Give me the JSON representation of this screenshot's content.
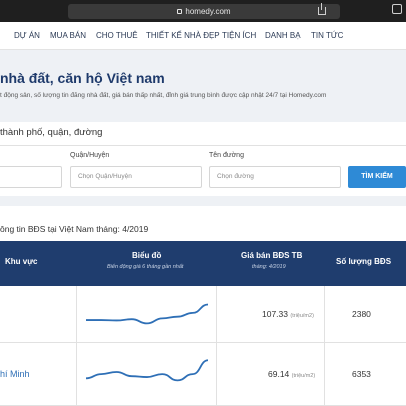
{
  "browser": {
    "url": "homedy.com"
  },
  "nav": {
    "items": [
      "DỰ ÁN",
      "MUA BÁN",
      "CHO THUÊ",
      "THIẾT KẾ NHÀ ĐẸP",
      "TIỆN ÍCH",
      "DANH BẠ",
      "TIN TỨC"
    ]
  },
  "hero": {
    "title": "nhà đất, căn hộ Việt nam",
    "subtitle": "t động sản, số lượng tin đăng nhà đất, giá bán thấp nhất, đỉnh giá trung bình được cập nhật 24/7 tại Homedy.com"
  },
  "search": {
    "title": "thành phố, quận, đường",
    "district_label": "Quận/Huyện",
    "district_placeholder": "Chọn Quận/Huyện",
    "street_label": "Tên đường",
    "street_placeholder": "Chọn đường",
    "button_label": "TÌM KIẾM"
  },
  "stats": {
    "title": "ông tin BĐS tại Việt Nam tháng: 4/2019",
    "headers": {
      "area": "Khu vực",
      "chart": "Biểu đồ",
      "chart_sub": "Biến động giá 6 tháng gần nhất",
      "price": "Giá bán BĐS TB",
      "price_sub": "tháng: 4/2019",
      "count": "Số lượng BĐS"
    },
    "unit": "(triệu/m2)",
    "rows": [
      {
        "area": "",
        "price": "107.33",
        "count": "2380",
        "trend": [
          0.38,
          0.38,
          0.37,
          0.4,
          0.3,
          0.42,
          0.46,
          0.55,
          0.75
        ]
      },
      {
        "area": "hí Minh",
        "price": "69.14",
        "count": "6353",
        "trend": [
          0.35,
          0.45,
          0.5,
          0.4,
          0.38,
          0.45,
          0.3,
          0.45,
          0.78
        ]
      }
    ]
  },
  "colors": {
    "header_bg": "#1f3d6e",
    "accent": "#2e8ad6",
    "line": "#2e6fb6"
  }
}
